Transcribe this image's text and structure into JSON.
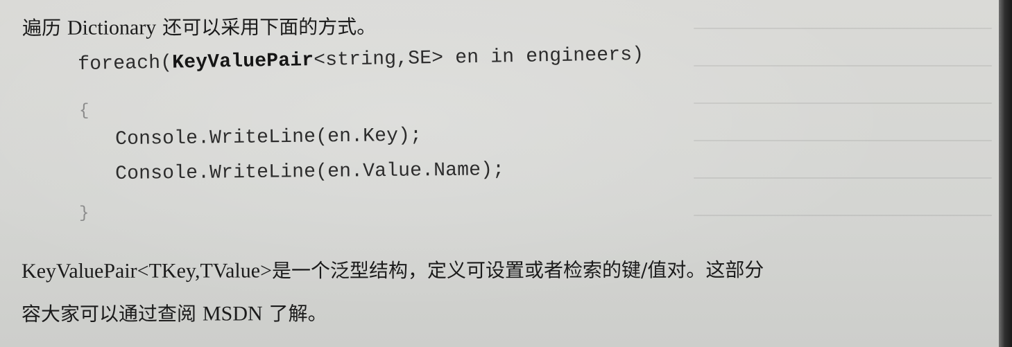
{
  "content": {
    "line1_prefix": "遍历 ",
    "line1_term": "Dictionary",
    "line1_suffix": " 还可以采用下面的方式。",
    "code_foreach": "foreach(",
    "code_type": "KeyValuePair",
    "code_generic": "<string,SE> en in engineers)",
    "code_open_brace": "{",
    "code_stmt_1": "Console.WriteLine(en.Key);",
    "code_stmt_2": "Console.WriteLine(en.Value.Name);",
    "code_close_brace": "}",
    "line2_term": "KeyValuePair<TKey,TValue>",
    "line2_suffix": "是一个泛型结构，定义可设置或者检索的键/值对。这部分",
    "line3_prefix": "容大家可以通过查阅 ",
    "line3_term": "MSDN",
    "line3_suffix": " 了解。"
  },
  "colors": {
    "paper": "#d6d7d4",
    "text": "#1d1d1d",
    "code": "#2c2c2c",
    "edge": "#1a1a1a"
  }
}
